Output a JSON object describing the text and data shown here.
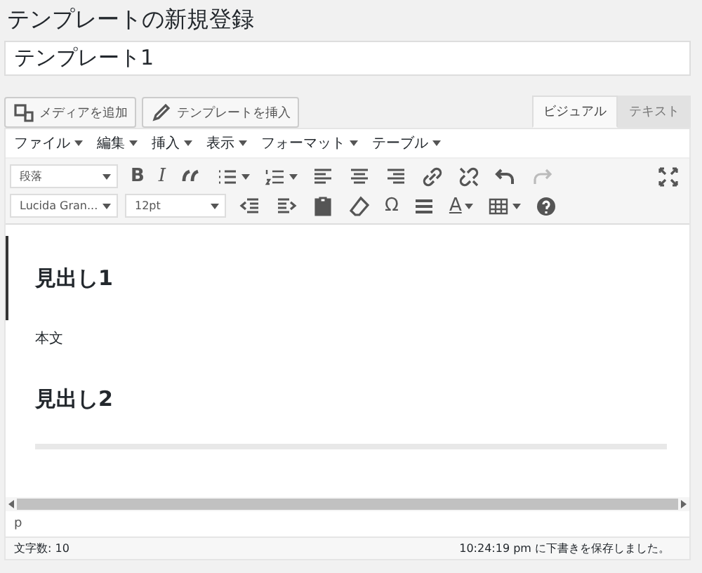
{
  "page_title": "テンプレートの新規登録",
  "title_field": {
    "value": "テンプレート1"
  },
  "media_buttons": [
    "メディアを追加",
    "テンプレートを挿入"
  ],
  "editor_tabs": [
    {
      "label": "ビジュアル",
      "selected": true
    },
    {
      "label": "テキスト",
      "selected": false
    }
  ],
  "menubar": [
    "ファイル",
    "編集",
    "挿入",
    "表示",
    "フォーマット",
    "テーブル"
  ],
  "toolbar_rows": [
    [
      {
        "kind": "select",
        "value": "段落"
      },
      {
        "kind": "glyph",
        "text": "B"
      },
      {
        "kind": "glyph",
        "text": "I"
      },
      {
        "kind": "icon",
        "dropdown": false,
        "disabled": false
      },
      {
        "kind": "icon",
        "dropdown": true,
        "disabled": false
      },
      {
        "kind": "icon",
        "dropdown": true,
        "disabled": false
      },
      {
        "kind": "icon",
        "dropdown": false,
        "disabled": false
      },
      {
        "kind": "icon",
        "dropdown": false,
        "disabled": false
      },
      {
        "kind": "icon",
        "dropdown": false,
        "disabled": false
      },
      {
        "kind": "icon",
        "dropdown": false,
        "disabled": false
      },
      {
        "kind": "icon",
        "dropdown": false,
        "disabled": false
      },
      {
        "kind": "icon",
        "dropdown": false,
        "disabled": false
      },
      {
        "kind": "icon",
        "dropdown": false,
        "disabled": true
      },
      {
        "kind": "spacer"
      },
      {
        "kind": "icon",
        "dropdown": false,
        "disabled": false
      }
    ],
    [
      {
        "kind": "select",
        "value": "Lucida Gran..."
      },
      {
        "kind": "select",
        "value": "12pt"
      },
      {
        "kind": "icon",
        "dropdown": false,
        "disabled": false
      },
      {
        "kind": "icon",
        "dropdown": false,
        "disabled": false
      },
      {
        "kind": "icon",
        "dropdown": false,
        "disabled": false
      },
      {
        "kind": "icon",
        "dropdown": false,
        "disabled": false
      },
      {
        "kind": "glyph",
        "text": "Ω"
      },
      {
        "kind": "icon",
        "dropdown": false,
        "disabled": false
      },
      {
        "kind": "glyph",
        "text": "A",
        "dropdown": true
      },
      {
        "kind": "icon",
        "dropdown": true,
        "disabled": false
      },
      {
        "kind": "icon",
        "dropdown": false,
        "disabled": false
      }
    ]
  ],
  "content": [
    {
      "kind": "heading",
      "text": "見出し1",
      "selected": true
    },
    {
      "kind": "paragraph",
      "text": "本文",
      "selected": false
    },
    {
      "kind": "heading",
      "text": "見出し2",
      "selected": false
    }
  ],
  "path": "p",
  "status_bar": {
    "word_count": "文字数: 10",
    "saved": "10:24:19 pm に下書きを保存しました。"
  }
}
